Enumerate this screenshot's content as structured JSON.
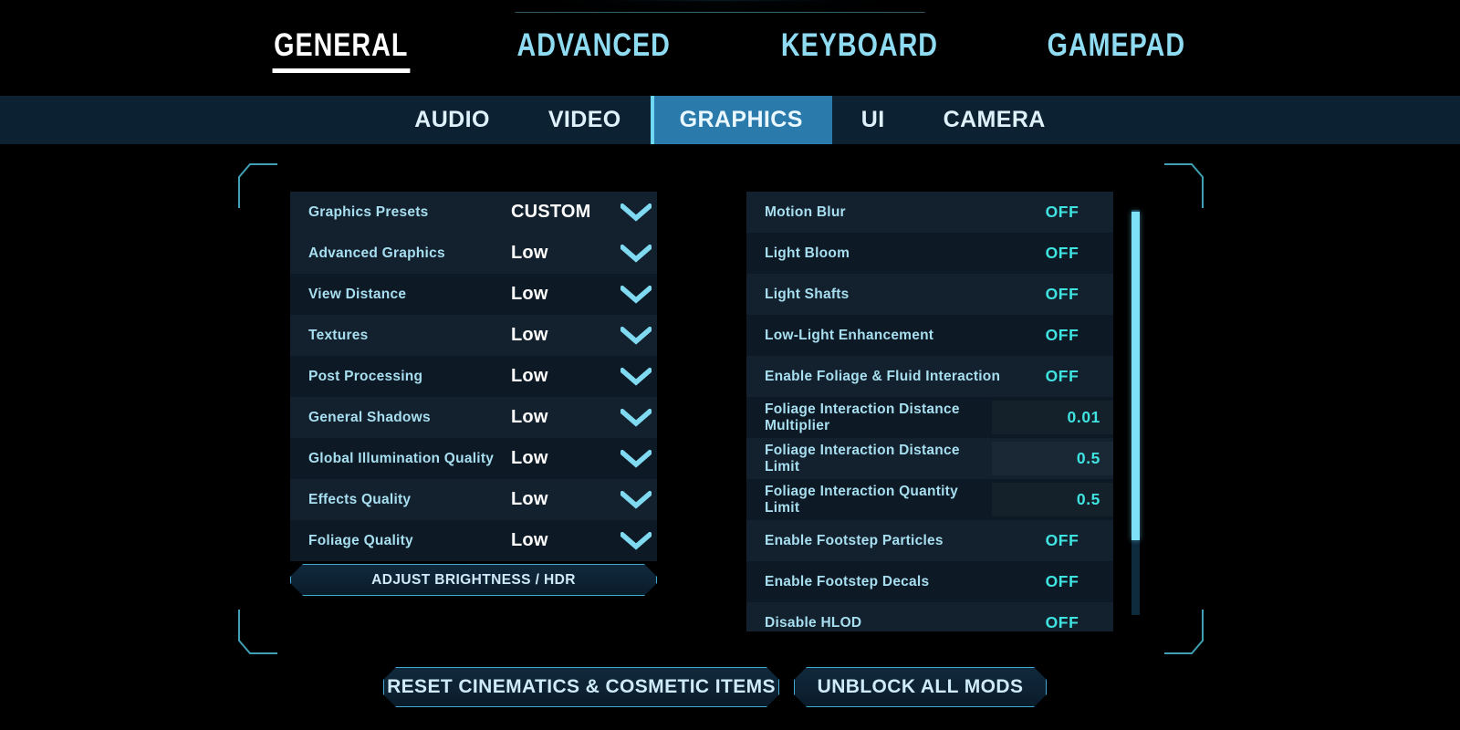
{
  "main_tabs": [
    {
      "label": "GENERAL",
      "active": true
    },
    {
      "label": "ADVANCED",
      "active": false
    },
    {
      "label": "KEYBOARD",
      "active": false
    },
    {
      "label": "GAMEPAD",
      "active": false
    }
  ],
  "sub_tabs": [
    {
      "label": "AUDIO",
      "active": false
    },
    {
      "label": "VIDEO",
      "active": false
    },
    {
      "label": "GRAPHICS",
      "active": true
    },
    {
      "label": "UI",
      "active": false
    },
    {
      "label": "CAMERA",
      "active": false
    }
  ],
  "left_panel": {
    "rows": [
      {
        "label": "Graphics Presets",
        "value": "CUSTOM",
        "control": "dropdown"
      },
      {
        "label": "Advanced Graphics",
        "value": "Low",
        "control": "dropdown"
      },
      {
        "label": "View Distance",
        "value": "Low",
        "control": "dropdown"
      },
      {
        "label": "Textures",
        "value": "Low",
        "control": "dropdown"
      },
      {
        "label": "Post Processing",
        "value": "Low",
        "control": "dropdown"
      },
      {
        "label": "General Shadows",
        "value": "Low",
        "control": "dropdown"
      },
      {
        "label": "Global Illumination Quality",
        "value": "Low",
        "control": "dropdown"
      },
      {
        "label": "Effects Quality",
        "value": "Low",
        "control": "dropdown"
      },
      {
        "label": "Foliage Quality",
        "value": "Low",
        "control": "dropdown"
      }
    ]
  },
  "right_panel": {
    "rows": [
      {
        "label": "Motion Blur",
        "value": "OFF",
        "control": "toggle"
      },
      {
        "label": "Light Bloom",
        "value": "OFF",
        "control": "toggle"
      },
      {
        "label": "Light Shafts",
        "value": "OFF",
        "control": "toggle"
      },
      {
        "label": "Low-Light Enhancement",
        "value": "OFF",
        "control": "toggle"
      },
      {
        "label": "Enable Foliage & Fluid Interaction",
        "value": "OFF",
        "control": "toggle"
      },
      {
        "label": "Foliage Interaction Distance Multiplier",
        "value": "0.01",
        "control": "slider"
      },
      {
        "label": "Foliage Interaction Distance Limit",
        "value": "0.5",
        "control": "slider"
      },
      {
        "label": "Foliage Interaction Quantity Limit",
        "value": "0.5",
        "control": "slider"
      },
      {
        "label": "Enable Footstep Particles",
        "value": "OFF",
        "control": "toggle"
      },
      {
        "label": "Enable Footstep Decals",
        "value": "OFF",
        "control": "toggle"
      },
      {
        "label": "Disable HLOD",
        "value": "OFF",
        "control": "toggle"
      }
    ]
  },
  "buttons": {
    "brightness": "ADJUST BRIGHTNESS / HDR",
    "reset": "RESET CINEMATICS & COSMETIC ITEMS",
    "unblock": "UNBLOCK ALL MODS"
  },
  "colors": {
    "accent_cyan": "#6fd8f5",
    "value_cyan": "#3fe3e0",
    "label_blue": "#a8dff0",
    "panel_bg": "#0d1924",
    "panel_row_alt": "#13212e",
    "subtab_bg": "#0c2233",
    "subtab_active": "#2a7aab",
    "page_bg": "#000000"
  }
}
